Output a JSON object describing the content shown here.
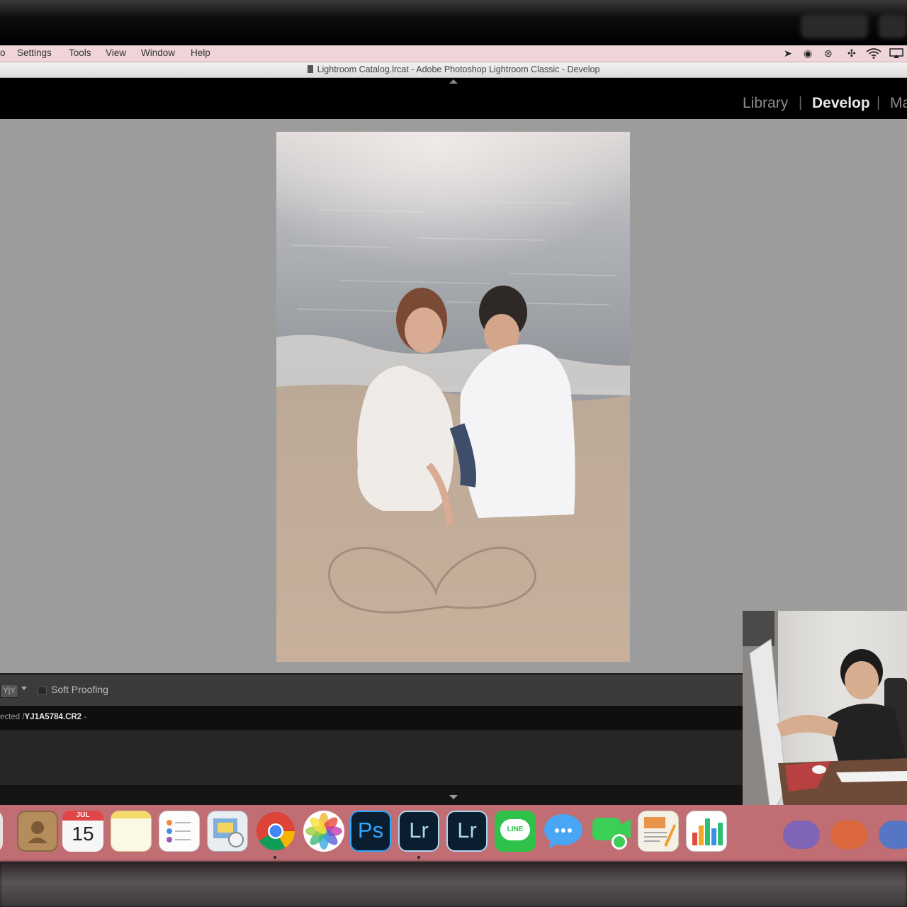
{
  "menubar": {
    "items": [
      "o",
      "Settings",
      "Tools",
      "View",
      "Window",
      "Help"
    ],
    "status_icons": [
      "location-arrow-icon",
      "record-icon",
      "creative-cloud-icon",
      "bluetooth-icon",
      "wifi-icon",
      "airplay-icon"
    ]
  },
  "window": {
    "title": "Lightroom Catalog.lrcat - Adobe Photoshop Lightroom Classic - Develop"
  },
  "module_picker": {
    "modules": [
      "Library",
      "Develop",
      "Ma"
    ],
    "active": "Develop"
  },
  "toolbar": {
    "view_mode": "Y|Y",
    "soft_proofing_label": "Soft Proofing",
    "soft_proofing_checked": false
  },
  "filmstrip": {
    "path_prefix": "ected /",
    "filename": "YJ1A5784.CR2",
    "dropdown": "-"
  },
  "dock": {
    "calendar_month": "JUL",
    "calendar_day": "15",
    "photoshop_label": "Ps",
    "lightroom_label": "Lr",
    "lightroom_classic_label": "Lr",
    "line_label": "LINE",
    "apps": [
      "contacts",
      "calendar",
      "notes",
      "reminders",
      "preview",
      "chrome",
      "photos",
      "photoshop",
      "lightroom",
      "lightroom-classic",
      "line",
      "messages",
      "facetime",
      "pages",
      "numbers"
    ]
  },
  "colors": {
    "menubar": "#efd4d8",
    "dock": "#c06d73",
    "canvas": "#9c9c9c",
    "module_active": "#e8e8e8",
    "module_inactive": "#8c8c8c"
  }
}
